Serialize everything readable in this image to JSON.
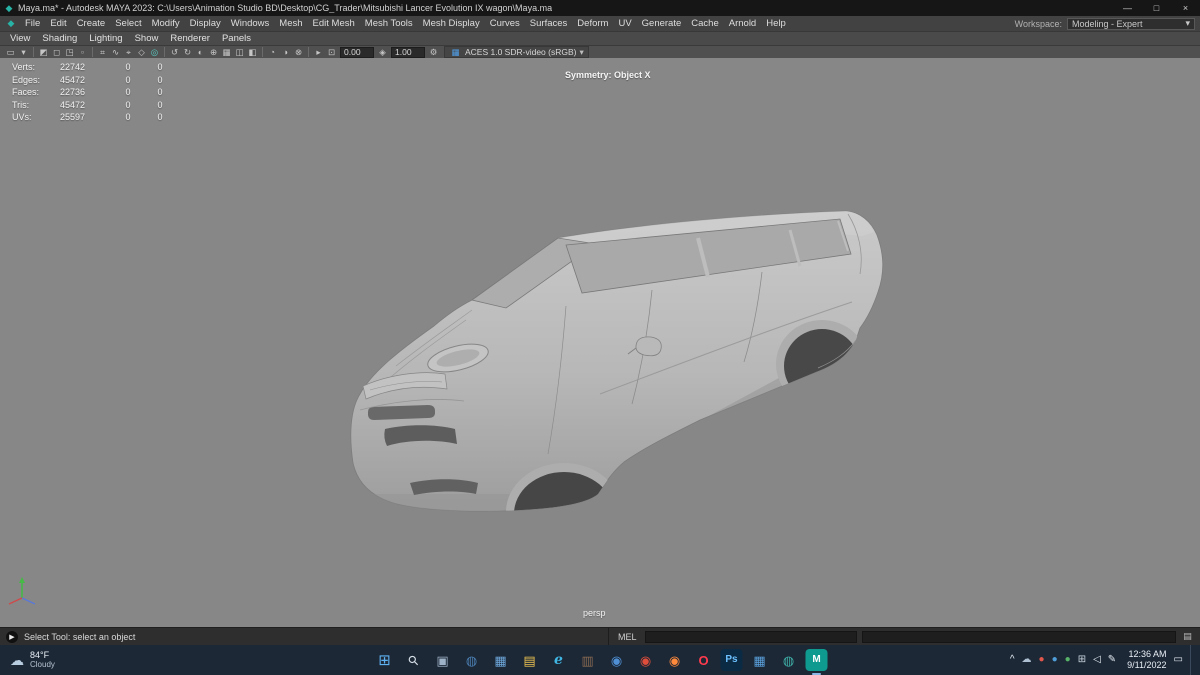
{
  "window": {
    "app_icon": "◆",
    "title": "Maya.ma* - Autodesk MAYA 2023: C:\\Users\\Animation Studio BD\\Desktop\\CG_Trader\\Mitsubishi Lancer Evolution IX wagon\\Maya.ma",
    "controls": {
      "minimize": "—",
      "maximize": "□",
      "close": "×"
    }
  },
  "menubar": {
    "logo": "◆",
    "items": [
      "File",
      "Edit",
      "Create",
      "Select",
      "Modify",
      "Display",
      "Windows",
      "Mesh",
      "Edit Mesh",
      "Mesh Tools",
      "Mesh Display",
      "Curves",
      "Surfaces",
      "Deform",
      "UV",
      "Generate",
      "Cache",
      "Arnold",
      "Help"
    ],
    "workspace_label": "Workspace:",
    "workspace_value": "Modeling - Expert",
    "workspace_caret": "▾"
  },
  "panelbar": {
    "items": [
      "View",
      "Shading",
      "Lighting",
      "Show",
      "Renderer",
      "Panels"
    ]
  },
  "statusline": {
    "icons": [
      {
        "name": "selection-mask-mode",
        "glyph": "▭"
      },
      {
        "name": "mode-caret",
        "glyph": "▾"
      },
      {
        "name": "select-hierarchy",
        "glyph": "◩"
      },
      {
        "name": "select-object",
        "glyph": "◻"
      },
      {
        "name": "select-component",
        "glyph": "◳"
      },
      {
        "name": "select-mask",
        "glyph": "▫"
      },
      {
        "name": "snap-grid",
        "glyph": "⌗"
      },
      {
        "name": "snap-curve",
        "glyph": "∿"
      },
      {
        "name": "snap-point",
        "glyph": "⌖"
      },
      {
        "name": "snap-plane",
        "glyph": "◇"
      },
      {
        "name": "make-live",
        "glyph": "◎",
        "color": "#58c5bd"
      },
      {
        "name": "history-undo",
        "glyph": "↺"
      },
      {
        "name": "history-redo",
        "glyph": "↻"
      },
      {
        "name": "symmetry-toggle",
        "glyph": "◐"
      },
      {
        "name": "highlight-toggle",
        "glyph": "⊕"
      },
      {
        "name": "texture-toggle",
        "glyph": "▦"
      },
      {
        "name": "wireframe-toggle",
        "glyph": "◫"
      },
      {
        "name": "shade-toggle",
        "glyph": "◧"
      },
      {
        "name": "render-frame",
        "glyph": "◔"
      },
      {
        "name": "ipr-render",
        "glyph": "◑"
      },
      {
        "name": "render-settings",
        "glyph": "⊗"
      },
      {
        "name": "expand-arrow",
        "glyph": "▸"
      },
      {
        "name": "soft-select",
        "glyph": "⊡"
      },
      {
        "name": "falloff",
        "glyph": "◈"
      },
      {
        "name": "settings-gear",
        "glyph": "⚙"
      },
      {
        "name": "colorspace",
        "glyph": "▦",
        "color": "#4f9ee8"
      }
    ],
    "translate_value": "0.00",
    "scale_value": "1.00",
    "colorspace_label": "ACES 1.0 SDR-video (sRGB)",
    "colorspace_caret": "▾"
  },
  "viewport": {
    "hud": {
      "rows": [
        {
          "label": "Verts:",
          "value": "22742",
          "a": "0",
          "b": "0"
        },
        {
          "label": "Edges:",
          "value": "45472",
          "a": "0",
          "b": "0"
        },
        {
          "label": "Faces:",
          "value": "22736",
          "a": "0",
          "b": "0"
        },
        {
          "label": "Tris:",
          "value": "45472",
          "a": "0",
          "b": "0"
        },
        {
          "label": "UVs:",
          "value": "25597",
          "a": "0",
          "b": "0"
        }
      ]
    },
    "symmetry_label": "Symmetry: Object X",
    "camera_label": "persp"
  },
  "bottombar": {
    "help_icon": "▶",
    "help_text": "Select Tool: select an object",
    "mel_label": "MEL",
    "script_icon": "▤"
  },
  "taskbar": {
    "weather": {
      "icon": "☁",
      "temp": "84°F",
      "condition": "Cloudy"
    },
    "icons": [
      {
        "name": "start-button",
        "glyph": "⊞",
        "color": "#5fb2f2"
      },
      {
        "name": "search-button",
        "glyph": "⚲",
        "color": "#d7dfe8"
      },
      {
        "name": "task-view-button",
        "glyph": "▣",
        "color": "#9fb3c8"
      },
      {
        "name": "chat-app",
        "glyph": "◍",
        "color": "#4b7fb3"
      },
      {
        "name": "store-app",
        "glyph": "▦",
        "color": "#6ea8dc"
      },
      {
        "name": "file-explorer",
        "glyph": "▤",
        "color": "#edc251"
      },
      {
        "name": "edge-browser",
        "glyph": "e",
        "color": "#3fb6e3"
      },
      {
        "name": "notepad-app",
        "glyph": "▥",
        "color": "#8a6a52"
      },
      {
        "name": "edge-dev-browser",
        "glyph": "◉",
        "color": "#4f8fd4"
      },
      {
        "name": "chrome-browser",
        "glyph": "◉",
        "color": "#de4e3b"
      },
      {
        "name": "firefox-browser",
        "glyph": "◉",
        "color": "#ff8a3c"
      },
      {
        "name": "opera-browser",
        "glyph": "O",
        "color": "#ff3b4e"
      },
      {
        "name": "photoshop-app",
        "glyph": "Ps",
        "color": "#6cc1ff",
        "bg": "#0b2a44"
      },
      {
        "name": "settings-app",
        "glyph": "▦",
        "color": "#5aa0dc"
      },
      {
        "name": "media-app",
        "glyph": "◍",
        "color": "#3fb0a8"
      },
      {
        "name": "maya-app",
        "glyph": "M",
        "color": "#ffffff",
        "bg": "#0f9a8f"
      }
    ],
    "tray": {
      "chevron": "^",
      "icons": [
        {
          "name": "onedrive-tray-icon",
          "glyph": "☁",
          "color": "#aebfd2"
        },
        {
          "name": "tray-app-red",
          "glyph": "●",
          "color": "#e2574c"
        },
        {
          "name": "tray-app-blue",
          "glyph": "●",
          "color": "#4f9ed9"
        },
        {
          "name": "tray-app-green",
          "glyph": "●",
          "color": "#58b368"
        },
        {
          "name": "touch-keyboard-icon",
          "glyph": "⊞",
          "color": "#cdd7e2"
        },
        {
          "name": "volume-icon",
          "glyph": "◁",
          "color": "#e6edf4"
        },
        {
          "name": "pen-icon",
          "glyph": "✎",
          "color": "#e6edf4"
        }
      ],
      "time": "12:36 AM",
      "date": "9/11/2022",
      "notification": "▭"
    }
  }
}
